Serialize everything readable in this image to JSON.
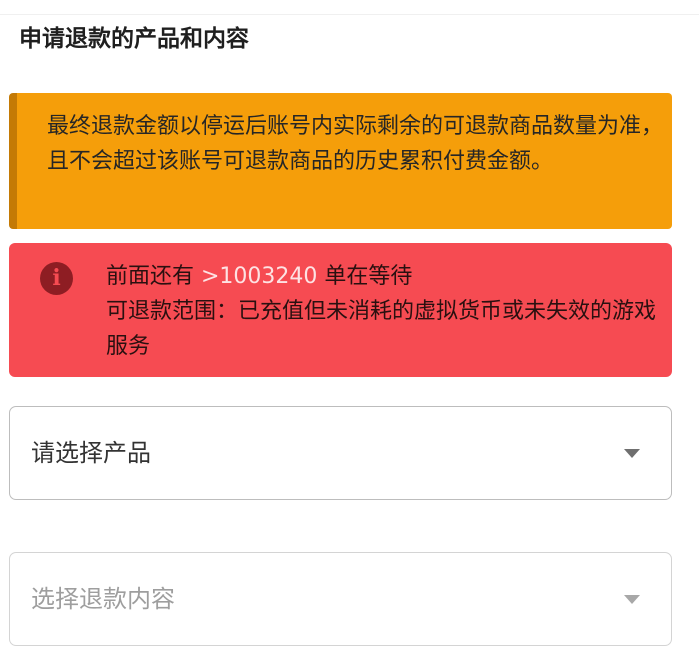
{
  "section": {
    "title": "申请退款的产品和内容"
  },
  "notice": {
    "text": "最终退款金额以停运后账号内实际剩余的可退款商品数量为准，且不会超过该账号可退款商品的历史累积付费金额。",
    "color": "#f59e0a"
  },
  "alert": {
    "icon": "info-icon",
    "line1_prefix": "前面还有 ",
    "line1_count": ">1003240",
    "line1_suffix": " 单在等待",
    "line2": "可退款范围：已充值但未消耗的虚拟货币或未失效的游戏服务",
    "color": "#f64b52"
  },
  "form": {
    "product_select": {
      "placeholder": "请选择产品",
      "icon": "chevron-down-icon"
    },
    "content_select": {
      "placeholder": "选择退款内容",
      "icon": "chevron-down-icon"
    }
  }
}
